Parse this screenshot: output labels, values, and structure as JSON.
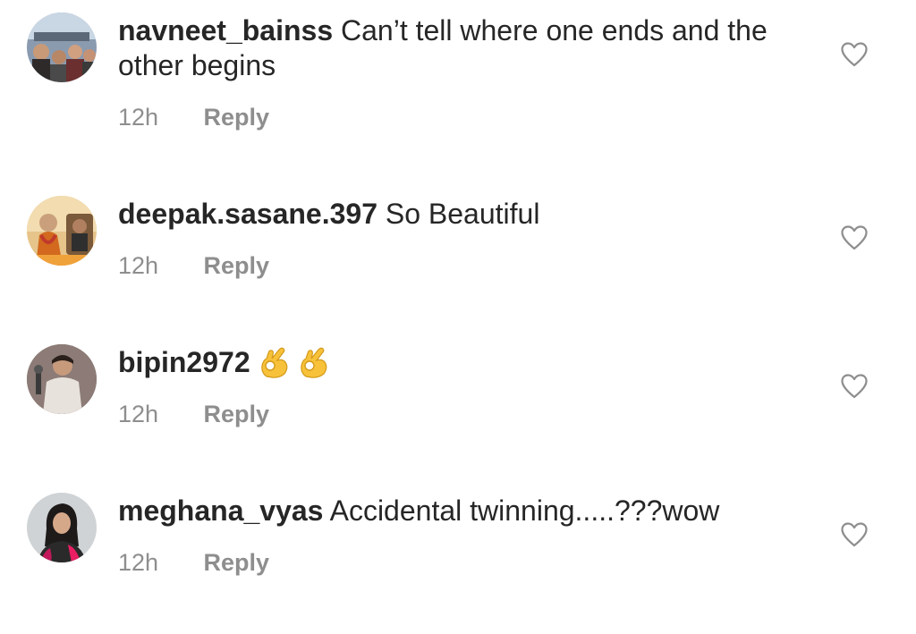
{
  "comments": [
    {
      "username": "navneet_bainss",
      "text": "Can’t tell where one ends and the other begins",
      "time": "12h",
      "reply_label": "Reply",
      "avatar_icon": "group-photo-avatar",
      "like_icon": "heart-outline-icon"
    },
    {
      "username": "deepak.sasane.397",
      "text": "So Beautiful",
      "time": "12h",
      "reply_label": "Reply",
      "avatar_icon": "festival-photo-avatar",
      "like_icon": "heart-outline-icon"
    },
    {
      "username": "bipin2972",
      "text": "",
      "emojis": [
        "ok-hand-emoji",
        "ok-hand-emoji"
      ],
      "time": "12h",
      "reply_label": "Reply",
      "avatar_icon": "man-photo-avatar",
      "like_icon": "heart-outline-icon"
    },
    {
      "username": "meghana_vyas",
      "text": "Accidental twinning.....???wow",
      "time": "12h",
      "reply_label": "Reply",
      "avatar_icon": "woman-photo-avatar",
      "like_icon": "heart-outline-icon"
    }
  ],
  "colors": {
    "text": "#262626",
    "meta": "#8e8e8e",
    "background": "#ffffff"
  }
}
